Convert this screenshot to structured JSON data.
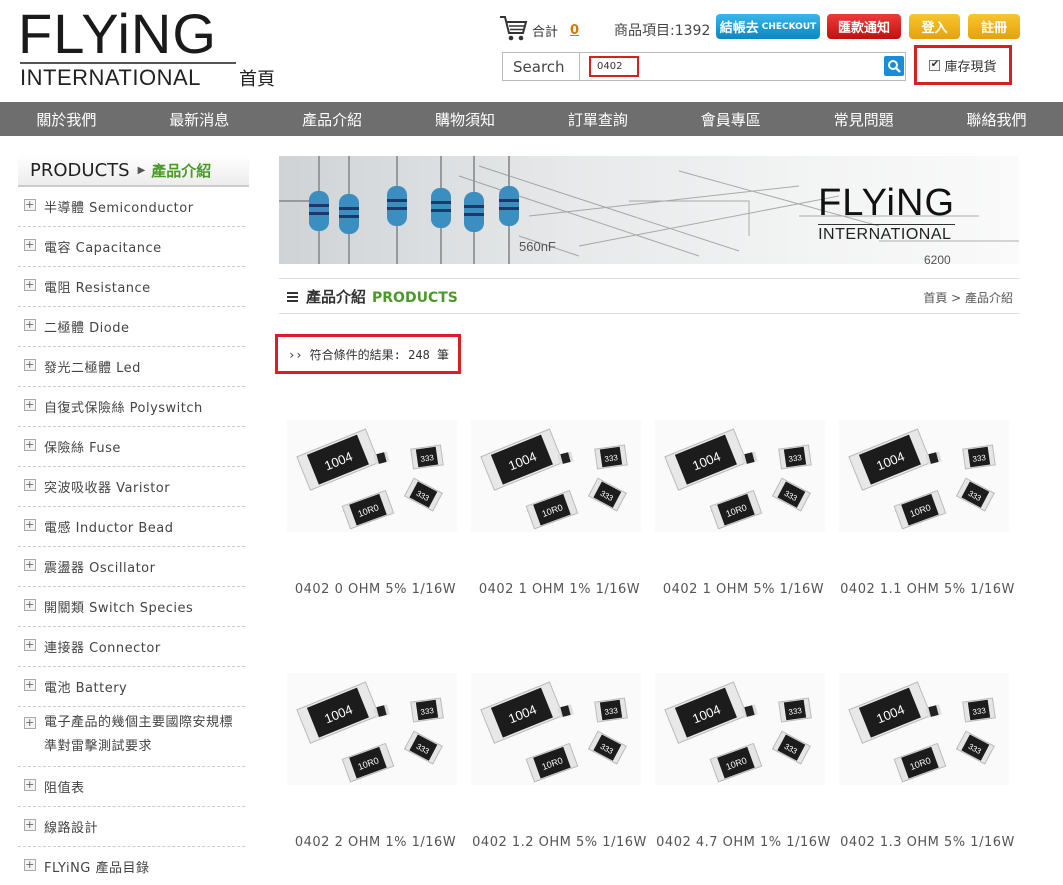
{
  "header": {
    "logo_top": "FLYiNG",
    "logo_bottom": "INTERNATIONAL",
    "logo_home": "首頁",
    "cart_label": "合計",
    "cart_count": "0",
    "items_label": "商品項目:1392",
    "checkout_label": "結帳去",
    "checkout_sub": "CHECKOUT",
    "remit_label": "匯款通知",
    "login_label": "登入",
    "register_label": "註冊",
    "search_label": "Search",
    "search_value": "0402",
    "stock_label": "庫存現貨",
    "stock_checked": true
  },
  "nav": {
    "items": [
      "關於我們",
      "最新消息",
      "產品介紹",
      "購物須知",
      "訂單查詢",
      "會員專區",
      "常見問題",
      "聯絡我們"
    ]
  },
  "sidebar": {
    "title_en": "PRODUCTS",
    "title_zh": "產品介紹",
    "items": [
      "半導體 Semiconductor",
      "電容 Capacitance",
      "電阻 Resistance",
      "二極體 Diode",
      "發光二極體 Led",
      "自復式保險絲 Polyswitch",
      "保險絲 Fuse",
      "突波吸收器 Varistor",
      "電感 Inductor Bead",
      "震盪器 Oscillator",
      "開關類 Switch Species",
      "連接器 Connector",
      "電池 Battery",
      "電子產品的幾個主要國際安規標準對雷擊測試要求",
      "阻值表",
      "線路設計",
      "FLYiNG 產品目錄"
    ]
  },
  "banner": {
    "logo_top": "FLYiNG",
    "logo_bottom": "INTERNATIONAL",
    "text_a": "560nF",
    "text_b": "6200"
  },
  "content": {
    "section_title": "產品介紹",
    "section_title_en": "PRODUCTS",
    "breadcrumb": "首頁 > 產品介紹",
    "result_text": "›› 符合條件的結果: 248 筆"
  },
  "products": [
    {
      "name": "0402 0 OHM 5% 1/16W"
    },
    {
      "name": "0402 1 OHM 1% 1/16W"
    },
    {
      "name": "0402 1 OHM 5% 1/16W"
    },
    {
      "name": "0402 1.1 OHM 5% 1/16W"
    },
    {
      "name": "0402 2 OHM 1% 1/16W"
    },
    {
      "name": "0402 1.2 OHM 5% 1/16W"
    },
    {
      "name": "0402 4.7 OHM 1% 1/16W"
    },
    {
      "name": "0402 1.3 OHM 5% 1/16W"
    }
  ],
  "chip_labels": {
    "big": "1004",
    "mid": "10R0",
    "small": "333"
  }
}
